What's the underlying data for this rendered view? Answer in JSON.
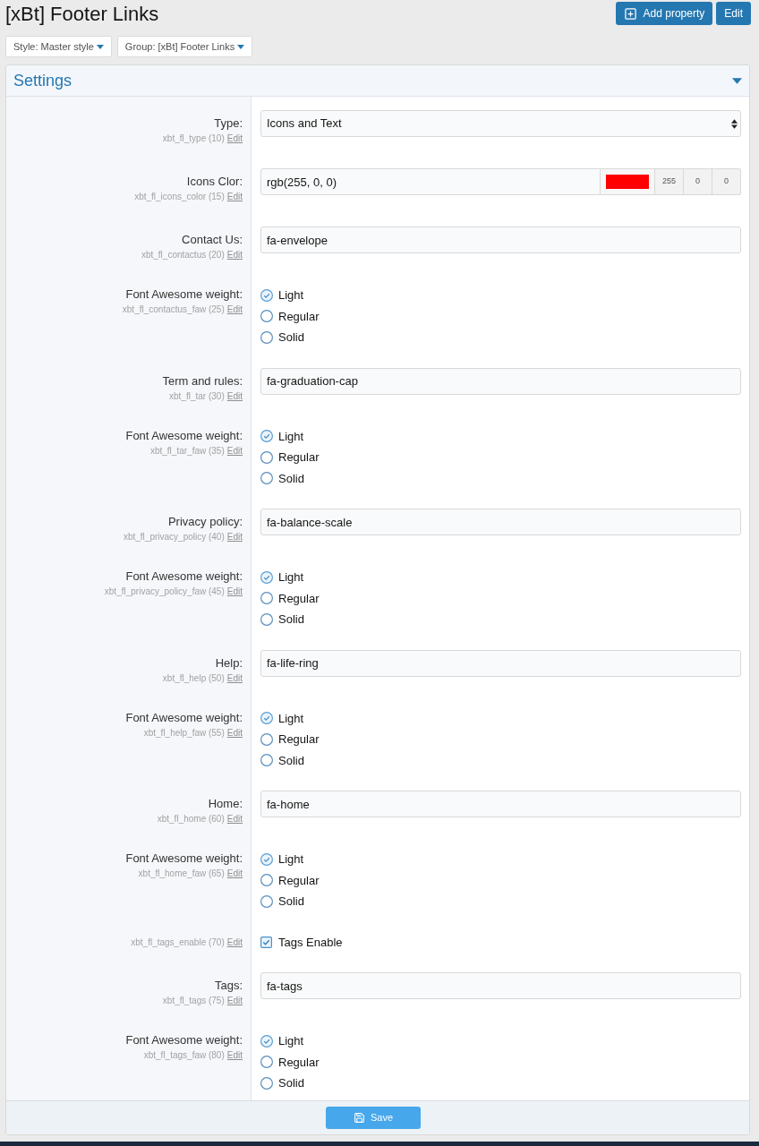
{
  "page": {
    "title": "[xBt] Footer Links",
    "buttons": [
      {
        "label": "Add property",
        "kind": "add"
      },
      {
        "label": "Edit",
        "kind": "plain"
      }
    ]
  },
  "filters": [
    {
      "label": "Style: Master style"
    },
    {
      "label": "Group: [xBt] Footer Links"
    }
  ],
  "panel": {
    "title": "Settings"
  },
  "rows": [
    {
      "kind": "select",
      "label": "Type:",
      "option_id": "xbt_fl_type (10)",
      "edit": "Edit",
      "value": "Icons and Text"
    },
    {
      "kind": "color",
      "label": "Icons Clor:",
      "option_id": "xbt_fl_icons_color (15)",
      "edit": "Edit",
      "value": "rgb(255, 0, 0)",
      "color": "#ff0000",
      "channels": [
        "255",
        "0",
        "0"
      ]
    },
    {
      "kind": "text",
      "label": "Contact Us:",
      "option_id": "xbt_fl_contactus (20)",
      "edit": "Edit",
      "value": "fa-envelope"
    },
    {
      "kind": "radio",
      "label": "Font Awesome weight:",
      "option_id": "xbt_fl_contactus_faw (25)",
      "edit": "Edit",
      "options": [
        {
          "label": "Light",
          "selected": true
        },
        {
          "label": "Regular",
          "selected": false
        },
        {
          "label": "Solid",
          "selected": false
        }
      ]
    },
    {
      "kind": "text",
      "label": "Term and rules:",
      "option_id": "xbt_fl_tar (30)",
      "edit": "Edit",
      "value": "fa-graduation-cap"
    },
    {
      "kind": "radio",
      "label": "Font Awesome weight:",
      "option_id": "xbt_fl_tar_faw (35)",
      "edit": "Edit",
      "options": [
        {
          "label": "Light",
          "selected": true
        },
        {
          "label": "Regular",
          "selected": false
        },
        {
          "label": "Solid",
          "selected": false
        }
      ]
    },
    {
      "kind": "text",
      "label": "Privacy policy:",
      "option_id": "xbt_fl_privacy_policy (40)",
      "edit": "Edit",
      "value": "fa-balance-scale"
    },
    {
      "kind": "radio",
      "label": "Font Awesome weight:",
      "option_id": "xbt_fl_privacy_policy_faw (45)",
      "edit": "Edit",
      "options": [
        {
          "label": "Light",
          "selected": true
        },
        {
          "label": "Regular",
          "selected": false
        },
        {
          "label": "Solid",
          "selected": false
        }
      ]
    },
    {
      "kind": "text",
      "label": "Help:",
      "option_id": "xbt_fl_help (50)",
      "edit": "Edit",
      "value": "fa-life-ring"
    },
    {
      "kind": "radio",
      "label": "Font Awesome weight:",
      "option_id": "xbt_fl_help_faw (55)",
      "edit": "Edit",
      "options": [
        {
          "label": "Light",
          "selected": true
        },
        {
          "label": "Regular",
          "selected": false
        },
        {
          "label": "Solid",
          "selected": false
        }
      ]
    },
    {
      "kind": "text",
      "label": "Home:",
      "option_id": "xbt_fl_home (60)",
      "edit": "Edit",
      "value": "fa-home"
    },
    {
      "kind": "radio",
      "label": "Font Awesome weight:",
      "option_id": "xbt_fl_home_faw (65)",
      "edit": "Edit",
      "options": [
        {
          "label": "Light",
          "selected": true
        },
        {
          "label": "Regular",
          "selected": false
        },
        {
          "label": "Solid",
          "selected": false
        }
      ]
    },
    {
      "kind": "checkbox",
      "option_id": "xbt_fl_tags_enable (70)",
      "edit": "Edit",
      "options": [
        {
          "label": "Tags Enable",
          "checked": true
        }
      ]
    },
    {
      "kind": "text",
      "label": "Tags:",
      "option_id": "xbt_fl_tags (75)",
      "edit": "Edit",
      "value": "fa-tags"
    },
    {
      "kind": "radio",
      "label": "Font Awesome weight:",
      "option_id": "xbt_fl_tags_faw (80)",
      "edit": "Edit",
      "options": [
        {
          "label": "Light",
          "selected": true
        },
        {
          "label": "Regular",
          "selected": false
        },
        {
          "label": "Solid",
          "selected": false
        }
      ]
    }
  ],
  "save_button": {
    "label": "Save"
  }
}
